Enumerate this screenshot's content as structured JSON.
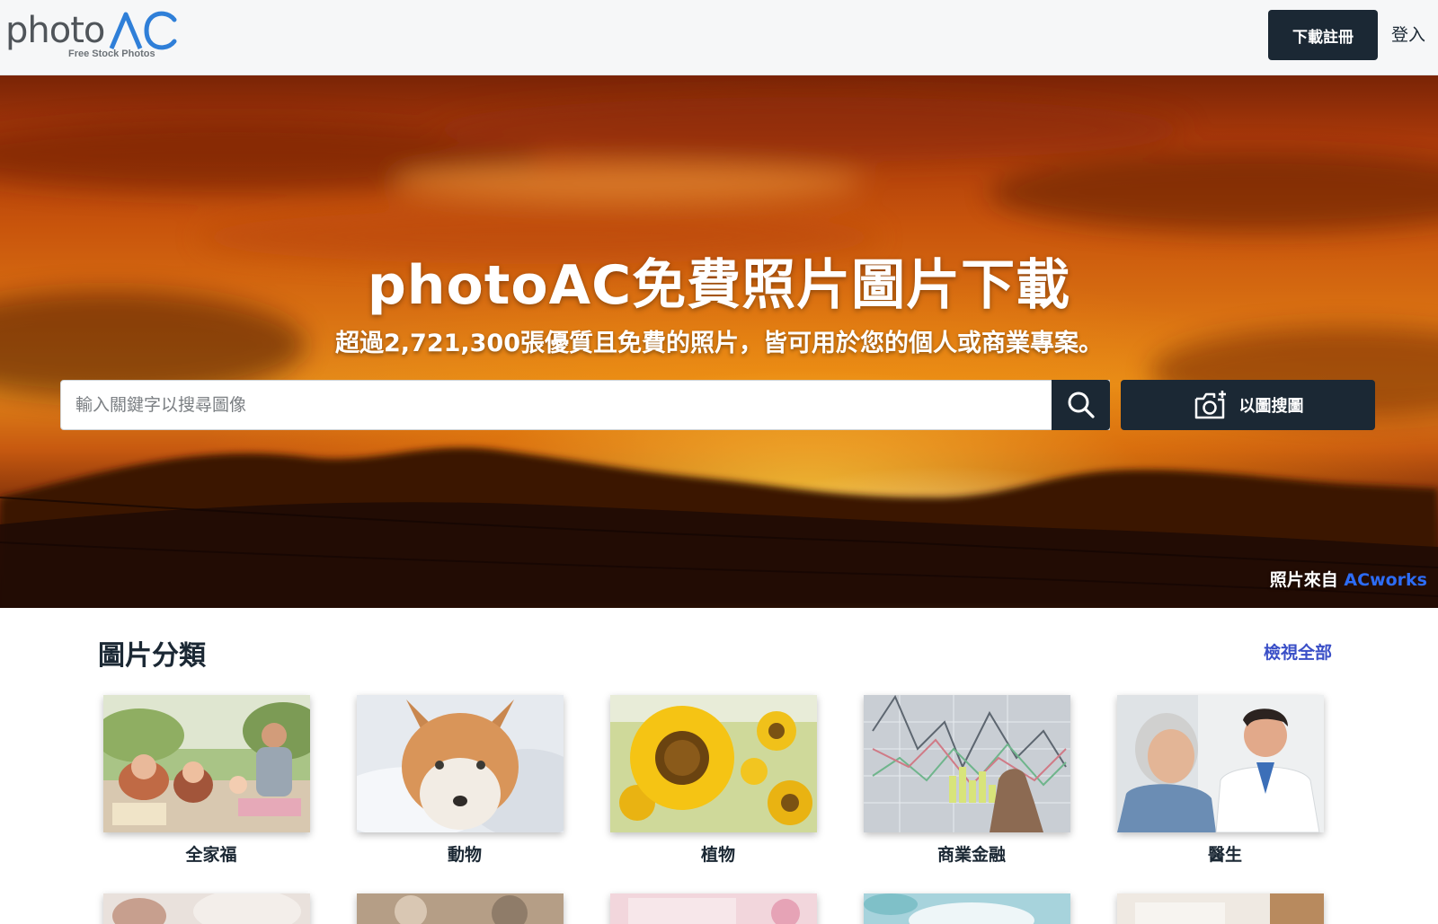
{
  "header": {
    "logo_word": "photo",
    "logo_sub": "Free Stock Photos",
    "register_label": "下載註冊",
    "login_label": "登入"
  },
  "hero": {
    "title": "photoAC免費照片圖片下載",
    "subtitle": "超過2,721,300張優質且免費的照片，皆可用於您的個人或商業專案。",
    "search_placeholder": "輸入關鍵字以搜尋圖像",
    "search_value": "",
    "image_search_label": "以圖搜圖",
    "credit_prefix": "照片來自",
    "credit_link": "ACworks"
  },
  "categories": {
    "title": "圖片分類",
    "view_all": "檢視全部",
    "items": [
      {
        "label": "全家福",
        "icon": "family-photo"
      },
      {
        "label": "動物",
        "icon": "fox-photo"
      },
      {
        "label": "植物",
        "icon": "sunflower-photo"
      },
      {
        "label": "商業金融",
        "icon": "finance-chart-photo"
      },
      {
        "label": "醫生",
        "icon": "doctor-photo"
      }
    ]
  },
  "colors": {
    "navy": "#1b2834",
    "link_blue": "#3a4fc7",
    "credit_blue": "#2d6cf6",
    "logo_blue": "#2f7fd8",
    "logo_gray": "#50555a"
  }
}
